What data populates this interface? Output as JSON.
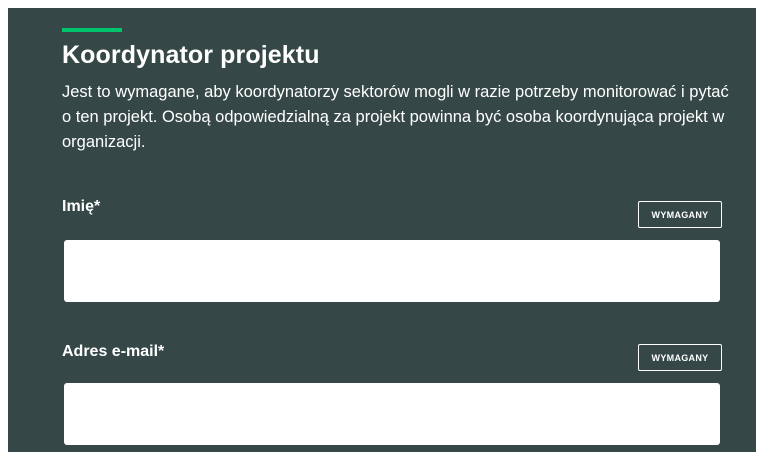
{
  "section": {
    "title": "Koordynator projektu",
    "description": "Jest to wymagane, aby koordynatorzy sektorów mogli w razie potrzeby monitorować i pytać o ten projekt. Osobą odpowiedzialną za projekt powinna być osoba koordynująca projekt w organizacji."
  },
  "fields": [
    {
      "label": "Imię*",
      "badge": "WYMAGANY",
      "value": "",
      "placeholder": ""
    },
    {
      "label": "Adres e-mail*",
      "badge": "WYMAGANY",
      "value": "",
      "placeholder": ""
    }
  ],
  "colors": {
    "panel_background": "#354847",
    "accent": "#00c46e",
    "text": "#ffffff",
    "input_background": "#ffffff"
  }
}
